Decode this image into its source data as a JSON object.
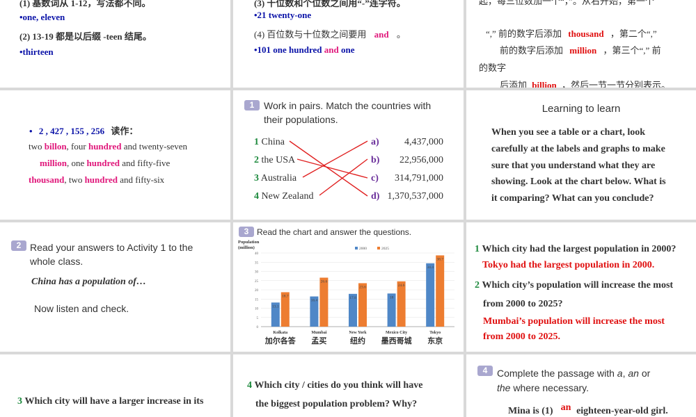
{
  "s1": {
    "line1": "(1) 基数词从 1-12，写法都不同。",
    "line2": "•one, eleven",
    "line3": "(2) 13-19 都是以后缀 -teen 结尾。",
    "line4": "•thirteen"
  },
  "s2": {
    "line1": "(3) 十位数和个位数之间用“-”连字符。",
    "line2": "•21 twenty-one",
    "line3_a": "(4) 百位数与十位数之间要用",
    "line3_and": "and",
    "line3_b": "。",
    "line4_a": "•101 one hundred",
    "line4_and": "and",
    "line4_b": "one"
  },
  "s3": {
    "line1": "起，每三位数加一个“，”。从右开始，第一个",
    "line2_a": "“,” 前的数字后添加",
    "line2_kw": "thousand",
    "line2_b": "，第二个“,”",
    "line3_a": "前的数字后添加",
    "line3_kw": "million",
    "line3_b": "，第三个“,” 前",
    "line4": "的数字",
    "line5_a": "后添加",
    "line5_kw": "billion",
    "line5_b": "，然后一节一节分别表示。"
  },
  "s4": {
    "number": "2 , 427 , 155 , 256",
    "read_as": "读作：",
    "w1": "two",
    "w2": "billon",
    "w3": ", four",
    "w4": "hundred",
    "w5": "and twenty-seven",
    "w6": "million",
    "w7": ", one",
    "w8": "hundred",
    "w9": "and fifty-five",
    "w10": "thousand",
    "w11": ", two",
    "w12": "hundred",
    "w13": "and fifty-six"
  },
  "s5": {
    "badge": "1",
    "instruction_l1": "Work  in pairs. Match the countries with",
    "instruction_l2": "their populations.",
    "countries": [
      {
        "num": "1",
        "name": "China"
      },
      {
        "num": "2",
        "name": "the USA"
      },
      {
        "num": "3",
        "name": "Australia"
      },
      {
        "num": "4",
        "name": "New Zealand"
      }
    ],
    "populations": [
      {
        "letter": "a)",
        "value": "4,437,000"
      },
      {
        "letter": "b)",
        "value": "22,956,000"
      },
      {
        "letter": "c)",
        "value": "314,791,000"
      },
      {
        "letter": "d)",
        "value": "1,370,537,000"
      }
    ]
  },
  "s6": {
    "title": "Learning to learn",
    "p1": "When you see a table or a chart, look",
    "p2": "carefully at the labels and graphs to make",
    "p3": "sure that you understand what they are",
    "p4": "showing. Look at the chart below. What is",
    "p5": "it comparing? What can you conclude?"
  },
  "s7": {
    "badge": "2",
    "l1": "Read your answers to Activity 1 to the",
    "l2": "whole class.",
    "example": "China has a population of…",
    "l3": "Now listen and check."
  },
  "s8": {
    "badge": "3",
    "instruction": "Read the chart and answer the questions.",
    "cn_labels": [
      "加尔各答",
      "孟买",
      "纽约",
      "墨西哥城",
      "东京"
    ]
  },
  "chart_data": {
    "type": "bar",
    "ylabel": "Population (million)",
    "ylim": [
      0,
      40
    ],
    "yticks": [
      0,
      5,
      10,
      15,
      20,
      25,
      30,
      35,
      40
    ],
    "categories": [
      "Kolkata",
      "Mumbai",
      "New York",
      "Mexico City",
      "Tokyo"
    ],
    "series": [
      {
        "name": "2000",
        "color": "#4f87c7",
        "values": [
          13.1,
          16.4,
          17.8,
          18.0,
          34.4
        ]
      },
      {
        "name": "2025",
        "color": "#ed7d31",
        "values": [
          18.7,
          26.6,
          23.6,
          24.6,
          38.7
        ]
      }
    ],
    "legend": "top"
  },
  "s9": {
    "q1_num": "1",
    "q1": "Which city had the largest population in 2000?",
    "a1": "Tokyo had the largest population in 2000.",
    "q2_num": "2",
    "q2_l1": "Which city’s population will increase the most",
    "q2_l2": "from 2000 to 2025?",
    "a2_l1": "Mumbai’s population will increase the most",
    "a2_l2": "from 2000 to 2025."
  },
  "s10": {
    "q3_num": "3",
    "q3": "Which city will have a larger increase in its"
  },
  "s11": {
    "q4_num": "4",
    "q4_l1": "Which city / cities do you think will have",
    "q4_l2": "the biggest population problem? Why?"
  },
  "s12": {
    "badge": "4",
    "l1_a": "Complete the passage with",
    "l1_a_word": "a",
    "l1_sep": ",",
    "l1_an_word": "an",
    "l1_or": "or",
    "l2_the": "the",
    "l2_rest": "where necessary.",
    "sent_a": "Mina is (1)",
    "blank": "an",
    "sent_b": "eighteen-year-old girl."
  },
  "colors": {
    "blue": "#0b13a8",
    "magenta": "#e0187b",
    "red": "#e01010",
    "green": "#1e8a3e",
    "badge": "#a9a7cf",
    "bar2000": "#4f87c7",
    "bar2025": "#ed7d31"
  }
}
